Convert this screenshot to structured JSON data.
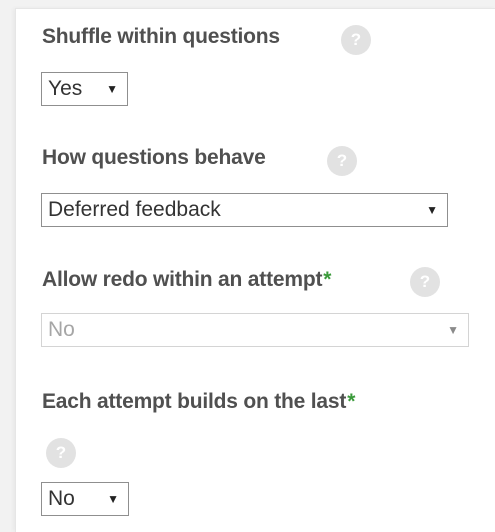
{
  "settings": [
    {
      "label": "Shuffle within questions",
      "required": "",
      "value": "Yes"
    },
    {
      "label": "How questions behave",
      "required": "",
      "value": "Deferred feedback"
    },
    {
      "label": "Allow redo within an attempt",
      "required": "*",
      "value": "No",
      "disabled": true
    },
    {
      "label": "Each attempt builds on the last",
      "required": "*",
      "value": "No"
    }
  ],
  "help_glyph": "?",
  "dropdown_glyph": "▼",
  "colors": {
    "required_marker": "#3a9a3a",
    "help_icon_bg": "#e2e2e2",
    "label": "#505050"
  }
}
